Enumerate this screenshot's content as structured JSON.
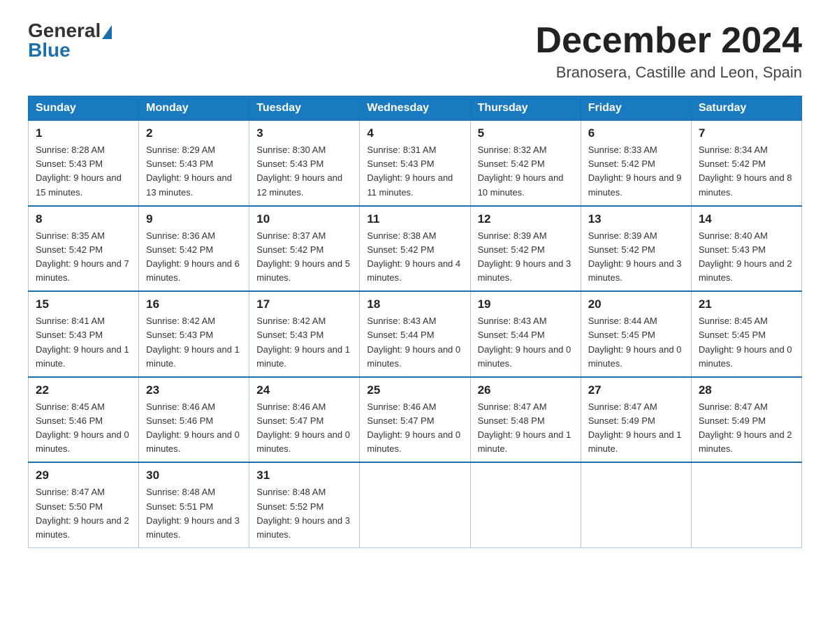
{
  "header": {
    "logo_general": "General",
    "logo_blue": "Blue",
    "month_title": "December 2024",
    "location": "Branosera, Castille and Leon, Spain"
  },
  "days_of_week": [
    "Sunday",
    "Monday",
    "Tuesday",
    "Wednesday",
    "Thursday",
    "Friday",
    "Saturday"
  ],
  "weeks": [
    [
      {
        "day": 1,
        "sunrise": "8:28 AM",
        "sunset": "5:43 PM",
        "daylight": "9 hours and 15 minutes."
      },
      {
        "day": 2,
        "sunrise": "8:29 AM",
        "sunset": "5:43 PM",
        "daylight": "9 hours and 13 minutes."
      },
      {
        "day": 3,
        "sunrise": "8:30 AM",
        "sunset": "5:43 PM",
        "daylight": "9 hours and 12 minutes."
      },
      {
        "day": 4,
        "sunrise": "8:31 AM",
        "sunset": "5:43 PM",
        "daylight": "9 hours and 11 minutes."
      },
      {
        "day": 5,
        "sunrise": "8:32 AM",
        "sunset": "5:42 PM",
        "daylight": "9 hours and 10 minutes."
      },
      {
        "day": 6,
        "sunrise": "8:33 AM",
        "sunset": "5:42 PM",
        "daylight": "9 hours and 9 minutes."
      },
      {
        "day": 7,
        "sunrise": "8:34 AM",
        "sunset": "5:42 PM",
        "daylight": "9 hours and 8 minutes."
      }
    ],
    [
      {
        "day": 8,
        "sunrise": "8:35 AM",
        "sunset": "5:42 PM",
        "daylight": "9 hours and 7 minutes."
      },
      {
        "day": 9,
        "sunrise": "8:36 AM",
        "sunset": "5:42 PM",
        "daylight": "9 hours and 6 minutes."
      },
      {
        "day": 10,
        "sunrise": "8:37 AM",
        "sunset": "5:42 PM",
        "daylight": "9 hours and 5 minutes."
      },
      {
        "day": 11,
        "sunrise": "8:38 AM",
        "sunset": "5:42 PM",
        "daylight": "9 hours and 4 minutes."
      },
      {
        "day": 12,
        "sunrise": "8:39 AM",
        "sunset": "5:42 PM",
        "daylight": "9 hours and 3 minutes."
      },
      {
        "day": 13,
        "sunrise": "8:39 AM",
        "sunset": "5:42 PM",
        "daylight": "9 hours and 3 minutes."
      },
      {
        "day": 14,
        "sunrise": "8:40 AM",
        "sunset": "5:43 PM",
        "daylight": "9 hours and 2 minutes."
      }
    ],
    [
      {
        "day": 15,
        "sunrise": "8:41 AM",
        "sunset": "5:43 PM",
        "daylight": "9 hours and 1 minute."
      },
      {
        "day": 16,
        "sunrise": "8:42 AM",
        "sunset": "5:43 PM",
        "daylight": "9 hours and 1 minute."
      },
      {
        "day": 17,
        "sunrise": "8:42 AM",
        "sunset": "5:43 PM",
        "daylight": "9 hours and 1 minute."
      },
      {
        "day": 18,
        "sunrise": "8:43 AM",
        "sunset": "5:44 PM",
        "daylight": "9 hours and 0 minutes."
      },
      {
        "day": 19,
        "sunrise": "8:43 AM",
        "sunset": "5:44 PM",
        "daylight": "9 hours and 0 minutes."
      },
      {
        "day": 20,
        "sunrise": "8:44 AM",
        "sunset": "5:45 PM",
        "daylight": "9 hours and 0 minutes."
      },
      {
        "day": 21,
        "sunrise": "8:45 AM",
        "sunset": "5:45 PM",
        "daylight": "9 hours and 0 minutes."
      }
    ],
    [
      {
        "day": 22,
        "sunrise": "8:45 AM",
        "sunset": "5:46 PM",
        "daylight": "9 hours and 0 minutes."
      },
      {
        "day": 23,
        "sunrise": "8:46 AM",
        "sunset": "5:46 PM",
        "daylight": "9 hours and 0 minutes."
      },
      {
        "day": 24,
        "sunrise": "8:46 AM",
        "sunset": "5:47 PM",
        "daylight": "9 hours and 0 minutes."
      },
      {
        "day": 25,
        "sunrise": "8:46 AM",
        "sunset": "5:47 PM",
        "daylight": "9 hours and 0 minutes."
      },
      {
        "day": 26,
        "sunrise": "8:47 AM",
        "sunset": "5:48 PM",
        "daylight": "9 hours and 1 minute."
      },
      {
        "day": 27,
        "sunrise": "8:47 AM",
        "sunset": "5:49 PM",
        "daylight": "9 hours and 1 minute."
      },
      {
        "day": 28,
        "sunrise": "8:47 AM",
        "sunset": "5:49 PM",
        "daylight": "9 hours and 2 minutes."
      }
    ],
    [
      {
        "day": 29,
        "sunrise": "8:47 AM",
        "sunset": "5:50 PM",
        "daylight": "9 hours and 2 minutes."
      },
      {
        "day": 30,
        "sunrise": "8:48 AM",
        "sunset": "5:51 PM",
        "daylight": "9 hours and 3 minutes."
      },
      {
        "day": 31,
        "sunrise": "8:48 AM",
        "sunset": "5:52 PM",
        "daylight": "9 hours and 3 minutes."
      },
      null,
      null,
      null,
      null
    ]
  ]
}
